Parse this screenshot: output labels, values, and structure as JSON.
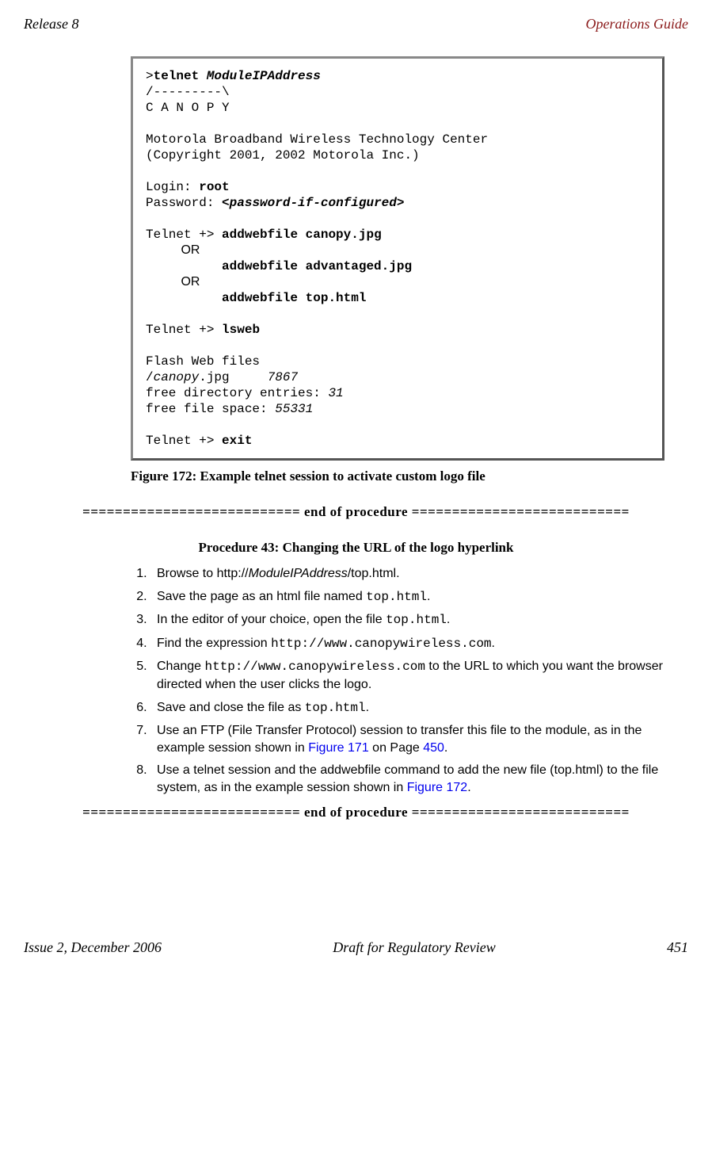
{
  "header": {
    "left": "Release 8",
    "right": "Operations Guide"
  },
  "terminal": {
    "prompt_gt": ">",
    "cmd_telnet": "telnet",
    "module_ip": "ModuleIPAddress",
    "line_slashes": "/---------\\",
    "canopy_spread": "C A N O P Y",
    "motorola_line": "Motorola Broadband Wireless Technology Center",
    "copyright_line": "(Copyright 2001, 2002 Motorola Inc.)",
    "login_label": "Login:",
    "login_val": "root",
    "password_label": "Password:",
    "lt": "<",
    "password_val": "password-if-configured",
    "gt": ">",
    "telnet_prompt": "Telnet +>",
    "addwebfile_canopy": "addwebfile canopy.jpg",
    "or_text": "OR",
    "addwebfile_adv": "addwebfile advantaged.jpg",
    "addwebfile_top": "addwebfile top.html",
    "lsweb": "lsweb",
    "flash_line": "Flash Web files",
    "canopy_jpg_prefix": "/",
    "canopy_jpg_name": "canopy",
    "canopy_jpg_ext": ".jpg",
    "canopy_jpg_size": "7867",
    "free_dir_label": "free directory entries:",
    "free_dir_val": "31",
    "free_file_label": "free file space:",
    "free_file_val": "55331",
    "exit": "exit"
  },
  "figure_caption": "Figure 172: Example telnet session to activate custom logo file",
  "end_of_procedure": "=========================== end of procedure ===========================",
  "procedure_title": "Procedure 43: Changing the URL of the logo hyperlink",
  "steps": {
    "s1_a": "Browse to http://",
    "s1_b": "ModuleIPAddress",
    "s1_c": "/top.html.",
    "s2_a": "Save the page as an html file named ",
    "s2_b": "top.html",
    "s2_c": ".",
    "s3_a": "In the editor of your choice, open the file ",
    "s3_b": "top.html",
    "s3_c": ".",
    "s4_a": "Find the expression ",
    "s4_b": "http://www.canopywireless.com",
    "s4_c": ".",
    "s5_a": "Change ",
    "s5_b": "http://www.canopywireless.com",
    "s5_c": " to the URL to which you want the browser directed when the user clicks the logo.",
    "s6_a": "Save and close the file as ",
    "s6_b": "top.html",
    "s6_c": ".",
    "s7_a": "Use an FTP (File Transfer Protocol) session to transfer this file to the module, as in the example session shown in ",
    "s7_b": "Figure 171",
    "s7_c": " on Page ",
    "s7_d": "450",
    "s7_e": ".",
    "s8_a": "Use a telnet session and the addwebfile command to add the new file (top.html) to the file system, as in the example session shown in ",
    "s8_b": "Figure 172",
    "s8_c": "."
  },
  "footer": {
    "left": "Issue 2, December 2006",
    "center": "Draft for Regulatory Review",
    "right": "451"
  }
}
